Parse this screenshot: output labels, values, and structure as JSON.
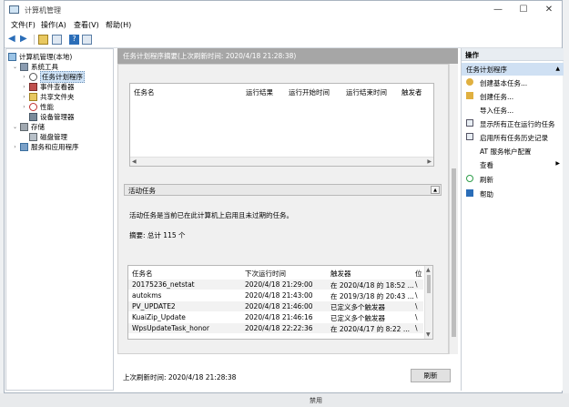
{
  "window": {
    "title": "计算机管理"
  },
  "menu": [
    "文件(F)",
    "操作(A)",
    "查看(V)",
    "帮助(H)"
  ],
  "tree": [
    {
      "label": "计算机管理(本地)",
      "level": 0,
      "expander": "",
      "icon": "computer-icon"
    },
    {
      "label": "系统工具",
      "level": 1,
      "expander": "⌄",
      "icon": "tools-icon"
    },
    {
      "label": "任务计划程序",
      "level": 2,
      "expander": "›",
      "icon": "clock-icon",
      "selected": true
    },
    {
      "label": "事件查看器",
      "level": 2,
      "expander": "›",
      "icon": "event-viewer-icon"
    },
    {
      "label": "共享文件夹",
      "level": 2,
      "expander": "›",
      "icon": "shared-folder-icon"
    },
    {
      "label": "性能",
      "level": 2,
      "expander": "›",
      "icon": "performance-icon"
    },
    {
      "label": "设备管理器",
      "level": 2,
      "expander": "",
      "icon": "device-manager-icon"
    },
    {
      "label": "存储",
      "level": 1,
      "expander": "⌄",
      "icon": "storage-icon"
    },
    {
      "label": "磁盘管理",
      "level": 2,
      "expander": "",
      "icon": "disk-icon"
    },
    {
      "label": "服务和应用程序",
      "level": 1,
      "expander": "›",
      "icon": "services-icon"
    }
  ],
  "center": {
    "header": "任务计划程序摘要(上次刷新时间: 2020/4/18 21:28:38)",
    "status_columns": [
      "任务名",
      "运行结果",
      "运行开始时间",
      "运行结束时间",
      "触发者"
    ],
    "active_section_title": "活动任务",
    "active_desc": "活动任务是当前已在此计算机上启用且未过期的任务。",
    "summary": "摘要: 总计 115 个",
    "active_columns": [
      "任务名",
      "下次运行时间",
      "触发器",
      "位"
    ],
    "active_rows": [
      [
        "20175236_netstat",
        "2020/4/18 21:29:00",
        "在 2020/4/18 的 18:52 ...",
        "\\"
      ],
      [
        "autokms",
        "2020/4/18 21:43:00",
        "在 2019/3/18 的 20:43 ...",
        "\\"
      ],
      [
        "PV_UPDATE2",
        "2020/4/18 21:46:00",
        "已定义多个触发器",
        "\\"
      ],
      [
        "KuaiZip_Update",
        "2020/4/18 21:46:16",
        "已定义多个触发器",
        "\\"
      ],
      [
        "WpsUpdateTask_honor",
        "2020/4/18 22:22:36",
        "在 2020/4/17 的 8:22 ...",
        "\\"
      ]
    ],
    "last_refresh": "上次刷新时间: 2020/4/18 21:28:38",
    "refresh_button": "刷新"
  },
  "actions": {
    "title": "操作",
    "subtitle": "任务计划程序",
    "items": [
      {
        "label": "创建基本任务...",
        "icon": "create-basic-task-icon"
      },
      {
        "label": "创建任务...",
        "icon": "create-task-icon"
      },
      {
        "label": "导入任务...",
        "icon": ""
      },
      {
        "label": "显示所有正在运行的任务",
        "icon": "running-tasks-icon"
      },
      {
        "label": "启用所有任务历史记录",
        "icon": "history-icon"
      },
      {
        "label": "AT 服务帐户配置",
        "icon": ""
      },
      {
        "label": "查看",
        "icon": "",
        "submenu": true
      },
      {
        "label": "刷新",
        "icon": "refresh-icon"
      },
      {
        "label": "帮助",
        "icon": "help-icon"
      }
    ]
  },
  "bottom": {
    "text": "禁用"
  }
}
